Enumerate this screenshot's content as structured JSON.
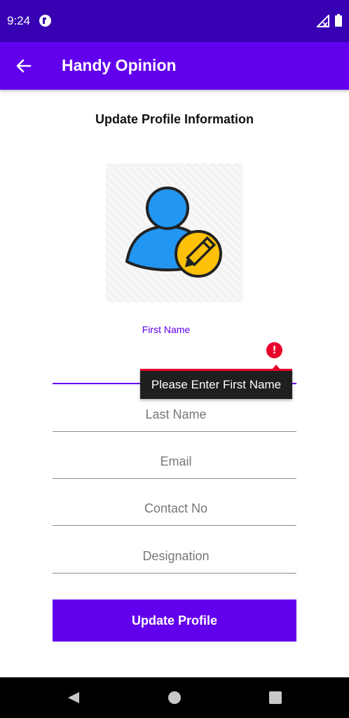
{
  "status_bar": {
    "time": "9:24"
  },
  "app_bar": {
    "title": "Handy Opinion"
  },
  "page": {
    "heading": "Update Profile Information"
  },
  "form": {
    "first_name": {
      "label": "First Name",
      "value": "",
      "error": "Please Enter First Name"
    },
    "last_name": {
      "placeholder": "Last Name",
      "value": ""
    },
    "email": {
      "placeholder": "Email",
      "value": ""
    },
    "contact_no": {
      "placeholder": "Contact No",
      "value": ""
    },
    "designation": {
      "placeholder": "Designation",
      "value": ""
    },
    "submit_label": "Update Profile"
  },
  "colors": {
    "status_bar": "#3700b3",
    "app_bar": "#6200ee",
    "accent": "#6200ee",
    "error": "#e8002b",
    "tooltip_bg": "#1f1f1f",
    "nav_bar": "#000000"
  },
  "icons": {
    "back": "arrow-left-icon",
    "avatar": "user-edit-icon",
    "error": "exclamation-circle-icon",
    "signal": "no-signal-icon",
    "battery": "battery-icon"
  }
}
